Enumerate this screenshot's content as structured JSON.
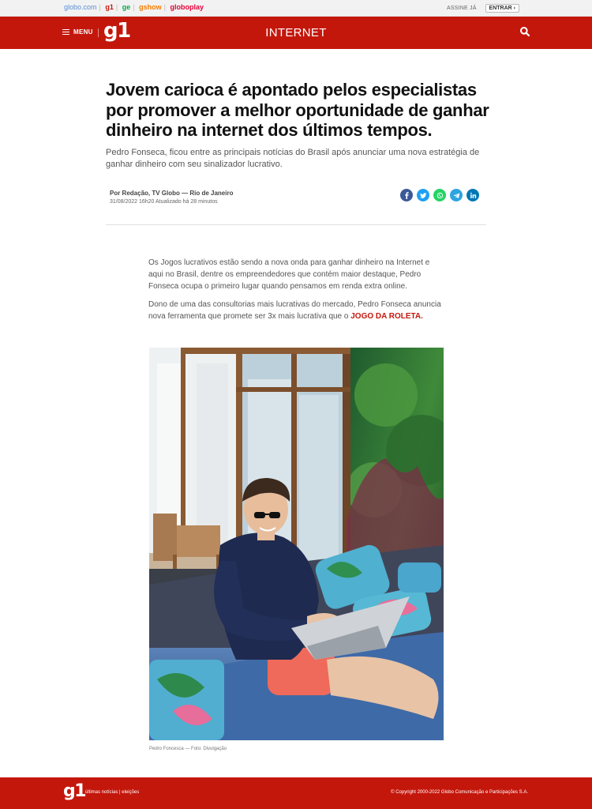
{
  "globobar": {
    "brands": [
      {
        "label": "globo.com",
        "color": "#5a8fd6"
      },
      {
        "label": "g1",
        "color": "#c4170c"
      },
      {
        "label": "ge",
        "color": "#06aa48"
      },
      {
        "label": "gshow",
        "color": "#f57c00"
      },
      {
        "label": "globoplay",
        "color": "#e4003a"
      }
    ],
    "assine": "ASSINE JÁ",
    "entrar": "ENTRAR ›"
  },
  "header": {
    "menu_label": "MENU",
    "logo": "g1",
    "section": "INTERNET",
    "search_icon": "search-icon",
    "brand_color": "#c4170c"
  },
  "article": {
    "title": "Jovem carioca é apontado pelos especialistas por promover a melhor oportunidade de ganhar dinheiro na internet dos últimos tempos.",
    "subtitle": "Pedro Fonseca, ficou entre as principais notícias do Brasil após anunciar uma nova estratégia de ganhar dinheiro com seu sinalizador lucrativo.",
    "byline": "Por Redação, TV Globo — Rio de Janeiro",
    "dates": "31/08/2022 16h20  Atualizado há 28 minutos",
    "share_icons": [
      {
        "name": "facebook-icon",
        "color": "#3b5998"
      },
      {
        "name": "twitter-icon",
        "color": "#1da1f2"
      },
      {
        "name": "whatsapp-icon",
        "color": "#25d366"
      },
      {
        "name": "telegram-icon",
        "color": "#2ca5e0"
      },
      {
        "name": "linkedin-icon",
        "color": "#0077b5"
      }
    ],
    "paragraph1": "Os Jogos lucrativos estão sendo a nova onda para ganhar dinheiro na Internet e aqui no Brasil, dentre os empreendedores que contém maior destaque, Pedro Fonseca ocupa o primeiro lugar quando pensamos em renda extra online.",
    "paragraph2_text": "Dono de uma das consultorias mais lucrativas do mercado, Pedro Fonseca anuncia nova ferramenta que promete ser 3x mais lucrativa que o ",
    "paragraph2_link": "JOGO DA ROLETA.",
    "photo_caption": "Pedro Foncesca — Foto: Divulgação"
  },
  "footer": {
    "logo": "g1",
    "links": "últimas notícias | eleições",
    "copyright": "© Copyright 2000-2022 Globo Comunicação e Participações S.A."
  }
}
